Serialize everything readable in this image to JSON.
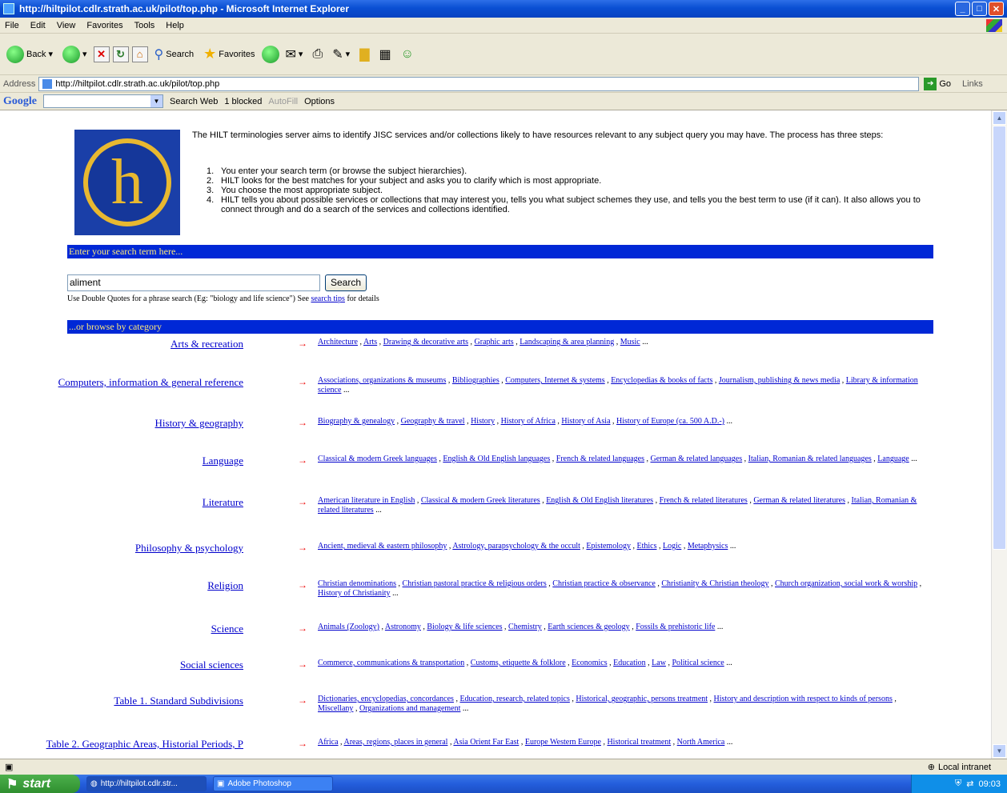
{
  "window": {
    "title": "http://hiltpilot.cdlr.strath.ac.uk/pilot/top.php - Microsoft Internet Explorer"
  },
  "menu": [
    "File",
    "Edit",
    "View",
    "Favorites",
    "Tools",
    "Help"
  ],
  "toolbar": {
    "back": "Back",
    "search": "Search",
    "favorites": "Favorites"
  },
  "address": {
    "label": "Address",
    "url": "http://hiltpilot.cdlr.strath.ac.uk/pilot/top.php",
    "go": "Go",
    "links": "Links"
  },
  "google": {
    "logo": "Google",
    "search_web": "Search Web",
    "blocked": "1 blocked",
    "autofill": "AutoFill",
    "options": "Options"
  },
  "page": {
    "logo_letter": "h",
    "intro": "The HILT terminologies server aims to identify JISC services and/or collections likely to have resources relevant to any subject query you may have. The process has three steps:",
    "steps": [
      {
        "num": "1.",
        "text": "You enter your search term (or browse the subject hierarchies)."
      },
      {
        "num": "2.",
        "text": "HILT looks for the best matches for your subject and asks you to clarify which is most appropriate."
      },
      {
        "num": "3.",
        "text": "You choose the most appropriate subject."
      },
      {
        "num": "4.",
        "text": "HILT tells you about possible services or collections that may interest you, tells you what subject schemes they use, and tells you the best term to use (if it can). It also allows you to connect through and do a search of the services and collections identified."
      }
    ],
    "search_header": "Enter your search term here...",
    "search_value": "aliment",
    "search_button": "Search",
    "hint_before": "Use Double Quotes for a phrase search (Eg: \"biology and life science\") See ",
    "hint_link": "search tips",
    "hint_after": " for details",
    "browse_header": "...or browse by category",
    "categories": [
      {
        "name": "Arts & recreation",
        "subs": [
          "Architecture",
          "Arts",
          "Drawing & decorative arts",
          "Graphic arts",
          "Landscaping & area planning",
          "Music"
        ]
      },
      {
        "name": "Computers, information & general reference",
        "subs": [
          "Associations, organizations & museums",
          "Bibliographies",
          "Computers, Internet & systems",
          "Encyclopedias & books of facts",
          "Journalism, publishing & news media",
          "Library & information science"
        ]
      },
      {
        "name": "History & geography",
        "subs": [
          "Biography & genealogy",
          "Geography & travel",
          "History",
          "History of Africa",
          "History of Asia",
          "History of Europe (ca. 500 A.D.-)"
        ]
      },
      {
        "name": "Language",
        "subs": [
          "Classical & modern Greek languages",
          "English & Old English languages",
          "French & related languages",
          "German & related languages",
          "Italian, Romanian & related languages",
          "Language"
        ]
      },
      {
        "name": "Literature",
        "subs": [
          "American literature in English",
          "Classical & modern Greek literatures",
          "English & Old English literatures",
          "French & related literatures",
          "German & related literatures",
          "Italian, Romanian & related literatures"
        ]
      },
      {
        "name": "Philosophy & psychology",
        "subs": [
          "Ancient, medieval & eastern philosophy",
          "Astrology, parapsychology & the occult",
          "Epistemology",
          "Ethics",
          "Logic",
          "Metaphysics"
        ]
      },
      {
        "name": "Religion",
        "subs": [
          "Christian denominations",
          "Christian pastoral practice & religious orders",
          "Christian practice & observance",
          "Christianity & Christian theology",
          "Church organization, social work & worship",
          "History of Christianity"
        ]
      },
      {
        "name": "Science",
        "subs": [
          "Animals (Zoology)",
          "Astronomy",
          "Biology & life sciences",
          "Chemistry",
          "Earth sciences & geology",
          "Fossils & prehistoric life"
        ]
      },
      {
        "name": "Social sciences",
        "subs": [
          "Commerce, communications & transportation",
          "Customs, etiquette & folklore",
          "Economics",
          "Education",
          "Law",
          "Political science"
        ]
      },
      {
        "name": "Table 1. Standard Subdivisions",
        "subs": [
          "Dictionaries, encyclopedias, concordances",
          "Education, research, related topics",
          "Historical, geographic, persons treatment",
          "History and description with respect to kinds of persons",
          "Miscellany",
          "Organizations and management"
        ]
      },
      {
        "name": "Table 2. Geographic Areas, Historial Periods, P",
        "subs": [
          "Africa",
          "Areas, regions, places in general",
          "Asia Orient Far East",
          "Europe Western Europe",
          "Historical treatment",
          "North America"
        ]
      }
    ],
    "ellipsis": "...",
    "arrow": "→"
  },
  "status": {
    "zone": "Local intranet"
  },
  "taskbar": {
    "start": "start",
    "tasks": [
      "http://hiltpilot.cdlr.str...",
      "Adobe Photoshop"
    ],
    "clock": "09:03"
  }
}
